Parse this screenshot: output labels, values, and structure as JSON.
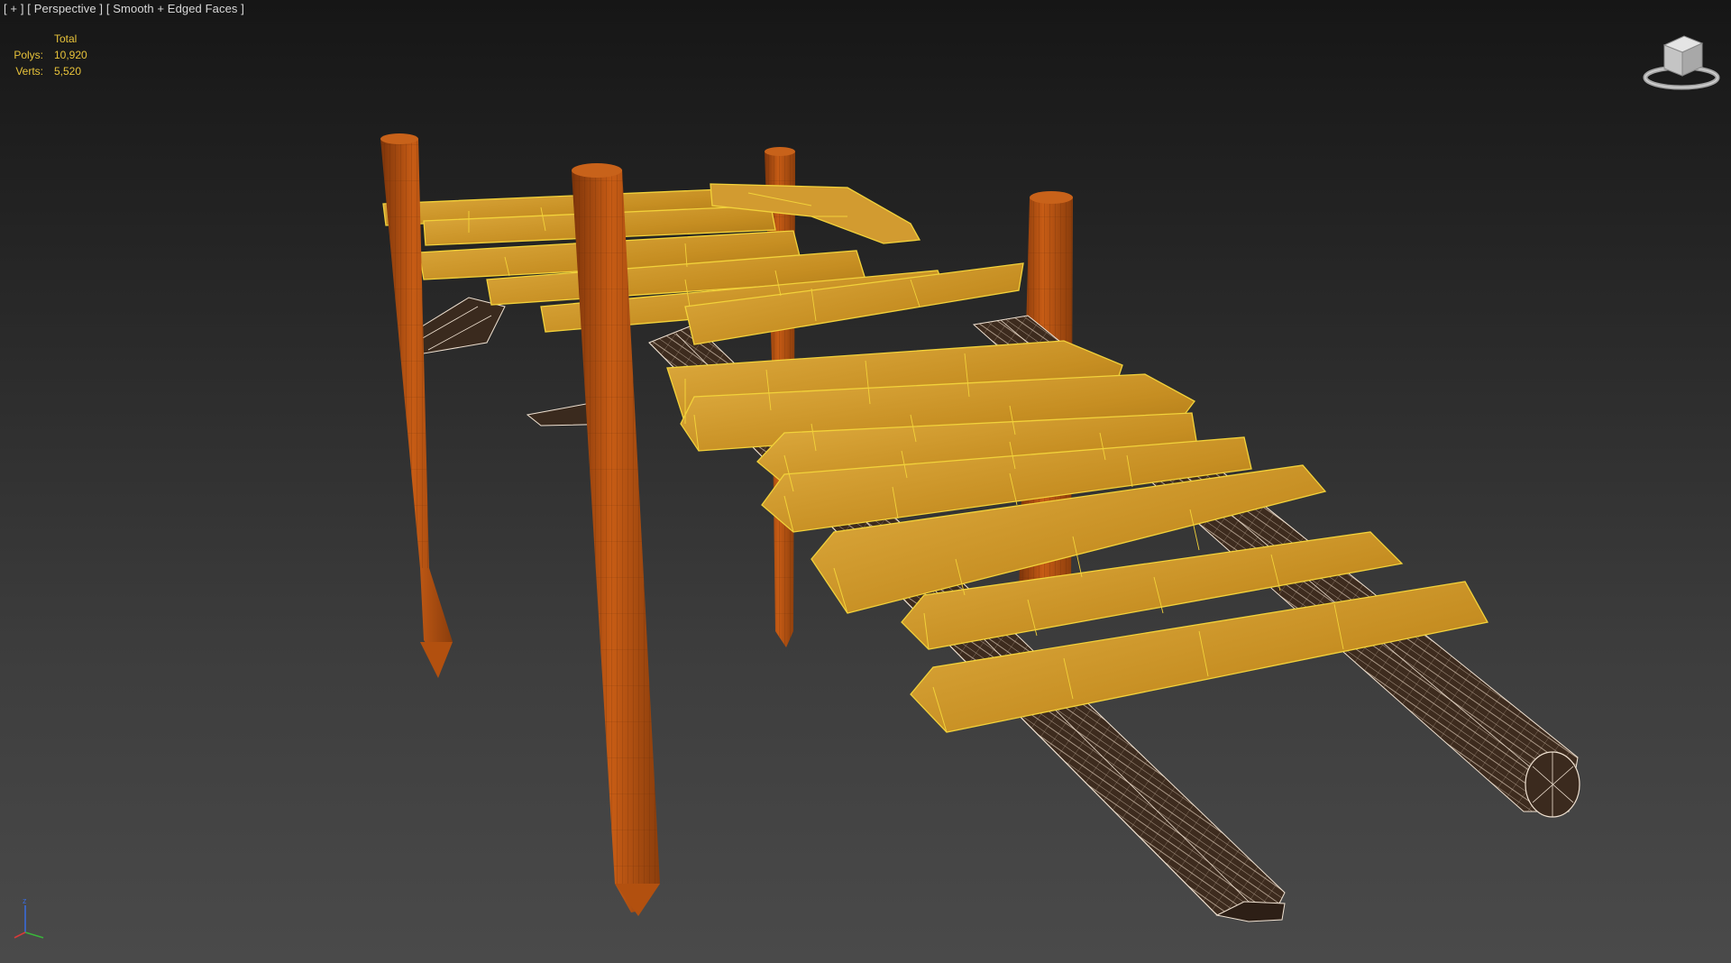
{
  "viewport": {
    "label_parts": [
      "[ + ]",
      "[ Perspective ]",
      "[ Smooth + Edged Faces ]"
    ]
  },
  "stats": {
    "header": "Total",
    "polys_label": "Polys:",
    "polys_value": "10,920",
    "verts_label": "Verts:",
    "verts_value": "5,520"
  },
  "axis": {
    "z": "z",
    "x": "x",
    "y": "y"
  },
  "colors": {
    "plank": "#c18a1e",
    "plank_light": "#d9a63a",
    "plank_dark": "#7a5208",
    "edge": "#f2d23a",
    "post": "#a4470f",
    "post_light": "#c75c15",
    "beam_wire": "#e8d7c4",
    "beam_fill": "#3a2a1e"
  },
  "icons": {
    "viewcube": "viewcube-icon",
    "axis": "axis-tripod-icon"
  }
}
